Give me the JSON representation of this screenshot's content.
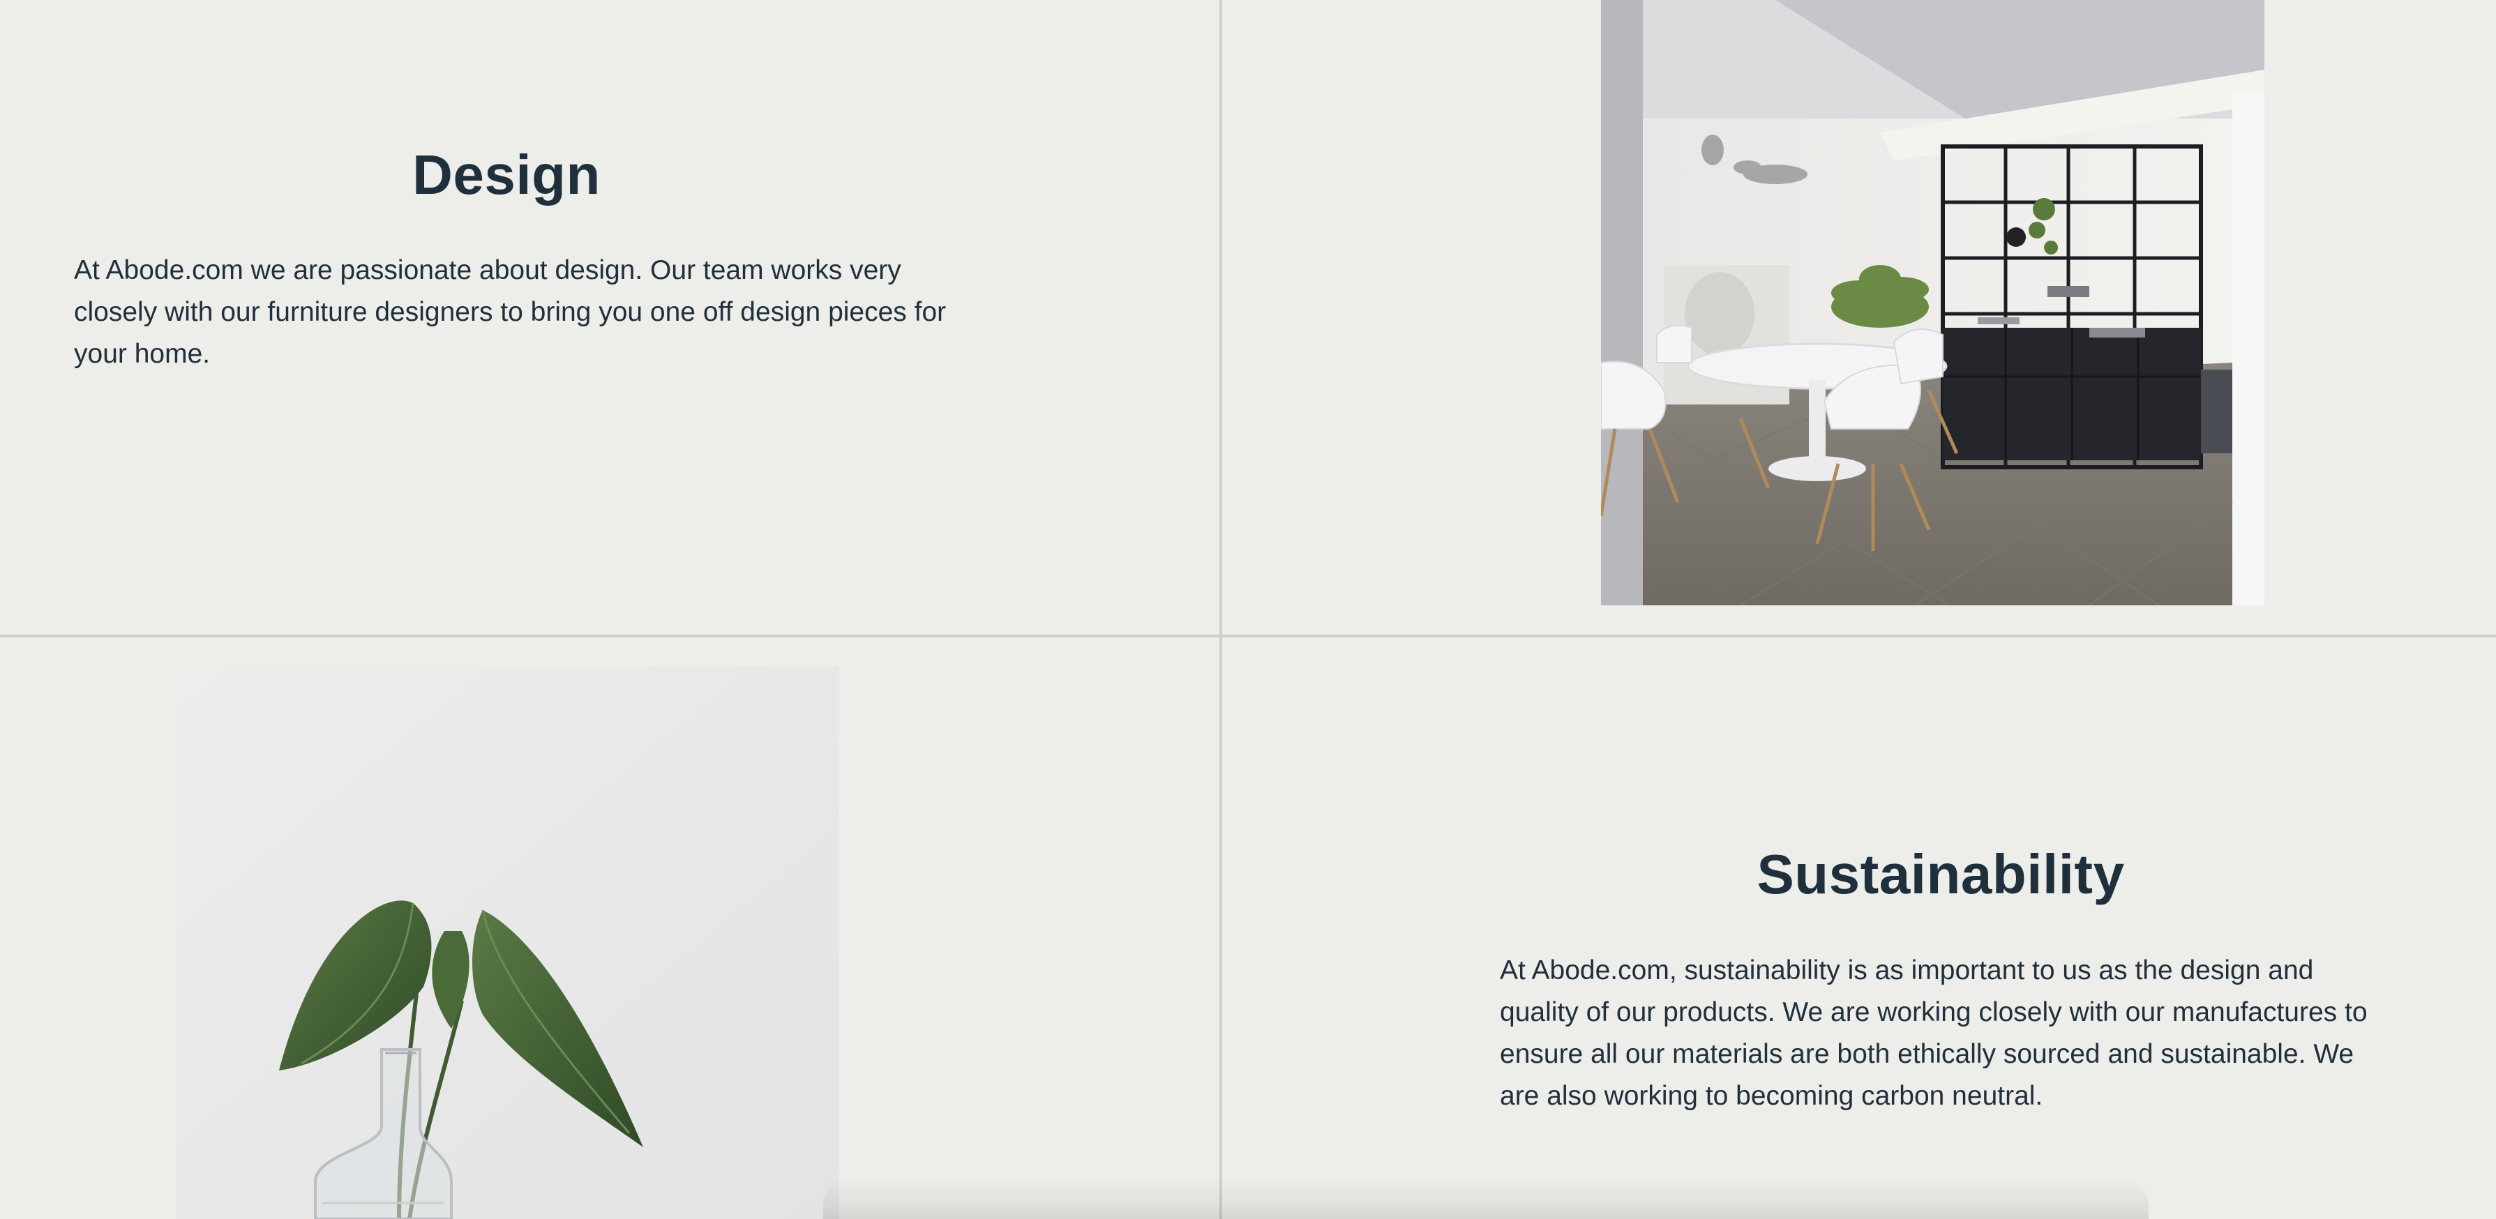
{
  "design": {
    "title": "Design",
    "body": "At Abode.com we are passionate about design. Our team works very closely with our furniture designers to bring you one off design pieces for your home."
  },
  "sustainability": {
    "title": "Sustainability",
    "body": "At Abode.com, sustainability is as important to us as the design and quality of our products. We are working closely with our manufactures to ensure all our materials are both ethically sourced and sustainable. We are also working to becoming carbon neutral."
  },
  "images": {
    "interior": "dining-room-photo",
    "plant": "plant-in-vase-photo"
  },
  "colors": {
    "background": "#edede9",
    "divider": "#cfcfcb",
    "heading": "#1f2f3c",
    "text": "#1f2f3c"
  }
}
